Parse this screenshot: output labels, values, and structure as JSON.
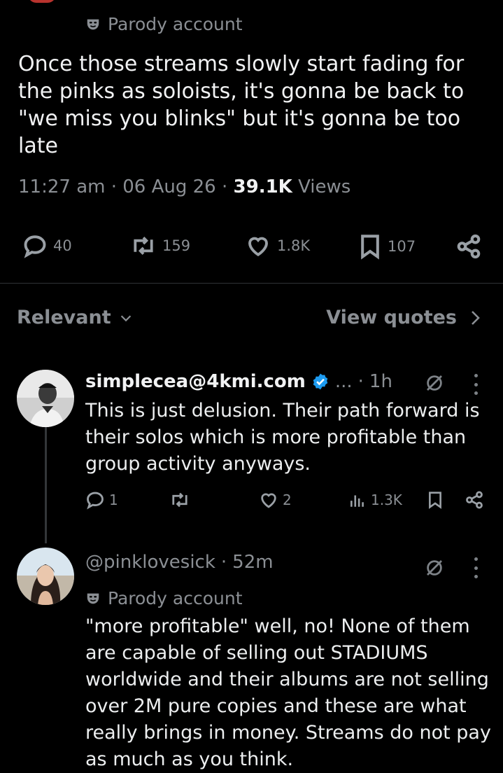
{
  "main_tweet": {
    "parody_label": "Parody account",
    "text": "Once those streams slowly start fading for the pinks as soloists, it's gonna be back to \"we miss you blinks\" but it's gonna be too late",
    "time": "11:27 am",
    "date": "06 Aug 26",
    "views_count": "39.1K",
    "views_label": "Views",
    "actions": {
      "replies": "40",
      "reposts": "159",
      "likes": "1.8K",
      "bookmarks": "107"
    }
  },
  "sort": {
    "relevant_label": "Relevant",
    "view_quotes_label": "View quotes"
  },
  "replies": [
    {
      "name": "simplecea@4kmi.com",
      "ellipsis": "...",
      "time": "1h",
      "text": "This is just delusion. Their path forward is their solos which is more profitable than group activity anyways.",
      "actions": {
        "replies": "1",
        "reposts": "",
        "likes": "2",
        "views": "1.3K"
      }
    },
    {
      "handle": "@pinklovesick",
      "time": "52m",
      "parody_label": "Parody account",
      "text": "\"more profitable\" well, no! None of them are capable of selling out STADIUMS worldwide and their albums are not selling over 2M pure copies and these are what really brings in money. Streams do not pay as much as you think."
    }
  ],
  "colors": {
    "background": "#000000",
    "text": "#e7e9ea",
    "muted": "#8b8f94",
    "verified": "#1d9bf0",
    "divider": "#2f3336"
  }
}
